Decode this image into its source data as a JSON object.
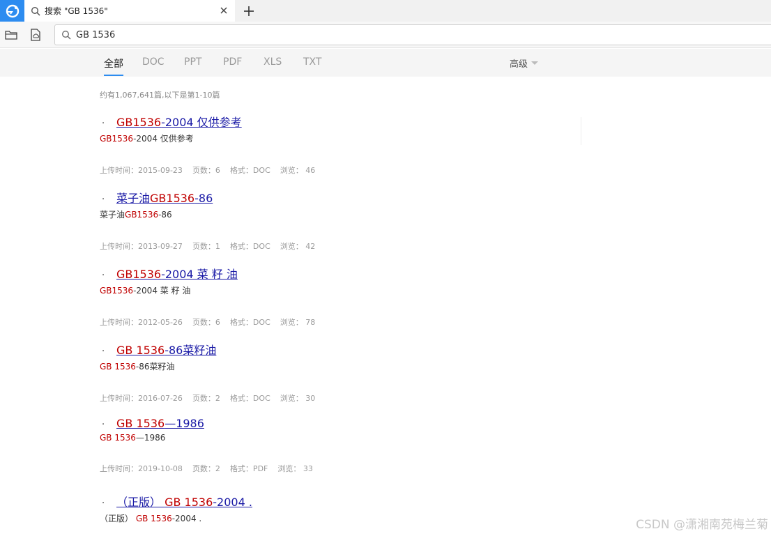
{
  "browser": {
    "tab_title": "搜索 \"GB 1536\"",
    "address_value": "GB 1536"
  },
  "filters": {
    "tabs": [
      "全部",
      "DOC",
      "PPT",
      "PDF",
      "XLS",
      "TXT"
    ],
    "active_index": 0,
    "advanced_label": "高级"
  },
  "summary": "约有1,067,641篇,以下是第1-10篇",
  "results": [
    {
      "title_hl": "GB1536",
      "title_rest": "-2004 仅供参考",
      "snippet_pre": "",
      "snippet_hl": "GB1536",
      "snippet_post": "-2004 仅供参考",
      "upload": "上传时间：2015-09-23",
      "pages": "页数：6",
      "format": "格式：DOC",
      "views": "浏览：  46"
    },
    {
      "title_pre": "菜子油",
      "title_hl": "GB1536",
      "title_rest": "-86",
      "snippet_pre": "菜子油",
      "snippet_hl": "GB1536",
      "snippet_post": "-86",
      "upload": "上传时间：2013-09-27",
      "pages": "页数：1",
      "format": "格式：DOC",
      "views": "浏览：  42"
    },
    {
      "title_hl": "GB1536",
      "title_rest": "-2004 菜 籽 油",
      "snippet_pre": "",
      "snippet_hl": "GB1536",
      "snippet_post": "-2004 菜 籽 油",
      "upload": "上传时间：2012-05-26",
      "pages": "页数：6",
      "format": "格式：DOC",
      "views": "浏览：  78"
    },
    {
      "title_hl": "GB 1536",
      "title_rest": "-86菜籽油",
      "snippet_pre": "",
      "snippet_hl": "GB 1536",
      "snippet_post": "-86菜籽油",
      "upload": "上传时间：2016-07-26",
      "pages": "页数：2",
      "format": "格式：DOC",
      "views": "浏览：  30"
    },
    {
      "title_hl": "GB 1536",
      "title_rest": "—1986",
      "snippet_pre": "",
      "snippet_hl": "GB 1536",
      "snippet_post": "—1986",
      "upload": "上传时间：2019-10-08",
      "pages": "页数：2",
      "format": "格式：PDF",
      "views": "浏览：  33"
    },
    {
      "title_pre": "（正版） ",
      "title_hl": "GB 1536",
      "title_rest": "-2004 .",
      "snippet_pre": "（正版） ",
      "snippet_hl": "GB 1536",
      "snippet_post": "-2004 ."
    }
  ],
  "watermark": "CSDN @潇湘南苑梅兰菊",
  "colors": {
    "accent": "#2d8cf0",
    "highlight": "#c00000",
    "link": "#1a1aa6"
  }
}
